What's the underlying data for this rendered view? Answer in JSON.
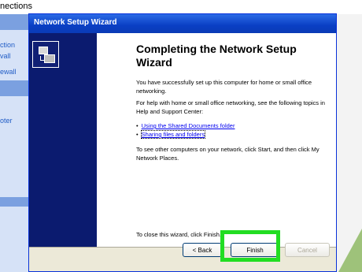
{
  "background_window": {
    "title": "nections",
    "sidebar_fragments": [
      "ction",
      "vall",
      "ewall",
      "oter"
    ]
  },
  "wizard": {
    "title": "Network Setup Wizard",
    "heading": "Completing the Network Setup Wizard",
    "para1": "You have successfully set up this computer for home or small office networking.",
    "para2": "For help with home or small office networking, see the following topics in Help and Support Center:",
    "links": [
      "Using the Shared Documents folder",
      "Sharing files and folders"
    ],
    "para3": "To see other computers on your network, click Start, and then click My Network Places.",
    "close_text": "To close this wizard, click Finish.",
    "buttons": {
      "back": "< Back",
      "finish": "Finish",
      "cancel": "Cancel"
    },
    "side_icon": "network-computers-icon"
  },
  "colors": {
    "titlebar": "#0a3fc4",
    "side_panel": "#0b1b6f",
    "highlight": "#22dd22",
    "link": "#0000ee"
  }
}
